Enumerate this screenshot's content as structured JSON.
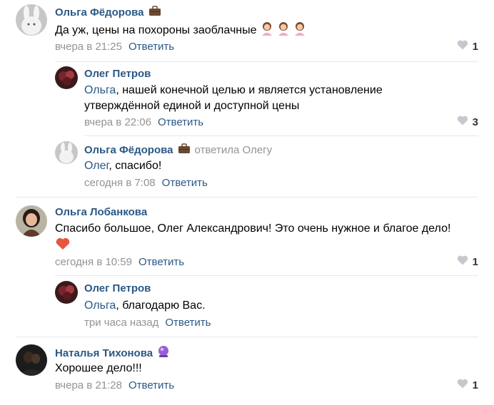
{
  "comments": [
    {
      "author": "Ольга Фёдорова",
      "text": "Да уж, цены на похороны заоблачные",
      "date": "вчера в 21:25",
      "reply": "Ответить",
      "likes": "1",
      "badge_icon": "briefcase-icon",
      "emoji_icon": "person-emoji-icon"
    },
    {
      "author": "Олег Петров",
      "mention": "Ольга",
      "text_line1": ", нашей конечной целью и является установление",
      "text_line2": "утверждённой единой и доступной цены",
      "date": "вчера в 22:06",
      "reply": "Ответить",
      "likes": "3"
    },
    {
      "author": "Ольга Фёдорова",
      "replied_to": "ответила Олегу",
      "mention": "Олег",
      "text": ", спасибо!",
      "date": "сегодня в 7:08",
      "reply": "Ответить",
      "badge_icon": "briefcase-icon"
    },
    {
      "author": "Ольга Лобанкова",
      "text": "Спасибо большое, Олег Александрович! Это очень нужное и благое дело!",
      "date": "сегодня в 10:59",
      "reply": "Ответить",
      "likes": "1",
      "emoji_icon": "heart-emoji-icon"
    },
    {
      "author": "Олег Петров",
      "mention": "Ольга",
      "text": ", благодарю Вас.",
      "date": "три часа назад",
      "reply": "Ответить"
    },
    {
      "author": "Наталья Тихонова",
      "text": "Хорошее дело!!!",
      "date": "вчера в 21:28",
      "reply": "Ответить",
      "likes": "1",
      "badge_icon": "crystal-ball-icon"
    }
  ],
  "colors": {
    "link": "#2a5885",
    "meta": "#939393",
    "divider": "#e7e8ec"
  }
}
